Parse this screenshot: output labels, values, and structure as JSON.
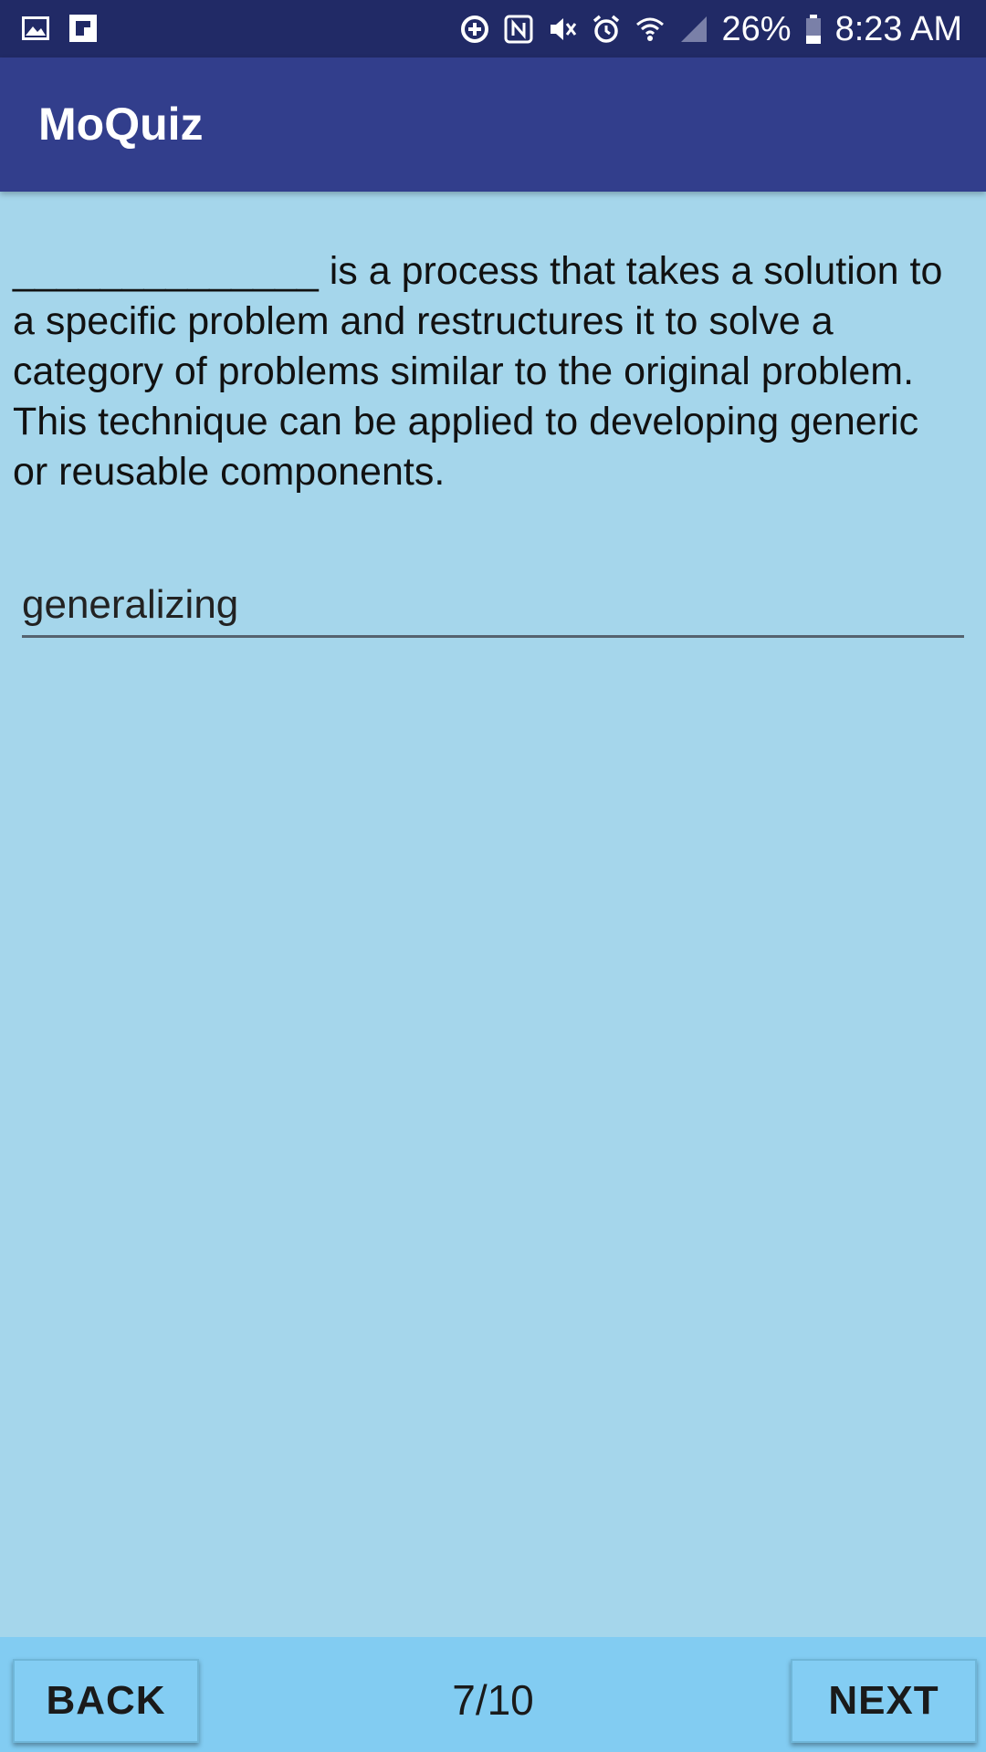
{
  "status_bar": {
    "left_icons": [
      "gallery-icon",
      "flipboard-icon"
    ],
    "right_icons": [
      "data-saver-icon",
      "nfc-icon",
      "vibrate-mute-icon",
      "alarm-icon",
      "wifi-icon",
      "signal-icon",
      "battery-icon"
    ],
    "battery": "26%",
    "time": "8:23 AM"
  },
  "app_bar": {
    "title": "MoQuiz"
  },
  "quiz": {
    "question": "______________ is a process that takes a solution to a specific problem and restructures it to solve a category of problems similar to the original problem. This technique can be applied to developing generic or reusable components.",
    "answer_value": "generalizing"
  },
  "navigation": {
    "back_label": "BACK",
    "next_label": "NEXT",
    "page": "7/10"
  },
  "colors": {
    "status_bar": "#212a66",
    "app_bar": "#323e8c",
    "background": "#a5d6eb",
    "bottom_bar": "#82ccf2"
  }
}
